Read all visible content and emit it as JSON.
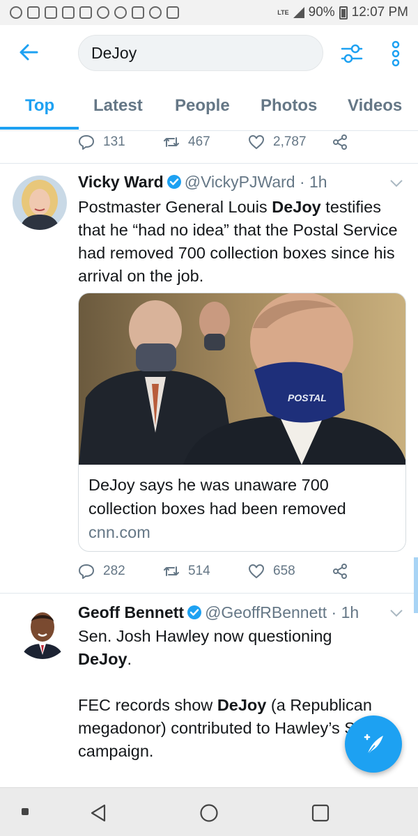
{
  "status_bar": {
    "battery": "90%",
    "time": "12:07 PM",
    "network": "LTE"
  },
  "search": {
    "query": "DeJoy"
  },
  "tabs": [
    {
      "label": "Top",
      "active": true
    },
    {
      "label": "Latest"
    },
    {
      "label": "People"
    },
    {
      "label": "Photos"
    },
    {
      "label": "Videos"
    }
  ],
  "prev_tweet_actions": {
    "replies": "131",
    "retweets": "467",
    "likes": "2,787"
  },
  "tweet1": {
    "name": "Vicky Ward",
    "handle": "@VickyPJWard · 1h",
    "text_a": "Postmaster General Louis ",
    "text_b": "DeJoy",
    "text_c": " testifies that he “had no idea” that the Postal Service had removed 700 collection boxes since his arrival on the job.",
    "card": {
      "title": "DeJoy says he was unaware 700 collection boxes had been removed",
      "domain": "cnn.com",
      "mask_text": "POSTAL"
    },
    "actions": {
      "replies": "282",
      "retweets": "514",
      "likes": "658"
    }
  },
  "tweet2": {
    "name": "Geoff Bennett",
    "handle": "@GeoffRBennett · 1h",
    "line1": "Sen. Josh Hawley now questioning",
    "line2": "DeJoy",
    "line2_suffix": ".",
    "p2_a": "FEC records show ",
    "p2_b": "DeJoy",
    "p2_c": " (a Republican megadonor) contributed to Hawley’s Senate campaign."
  },
  "colors": {
    "accent": "#1da1f2",
    "muted": "#657786",
    "text": "#14171a"
  }
}
